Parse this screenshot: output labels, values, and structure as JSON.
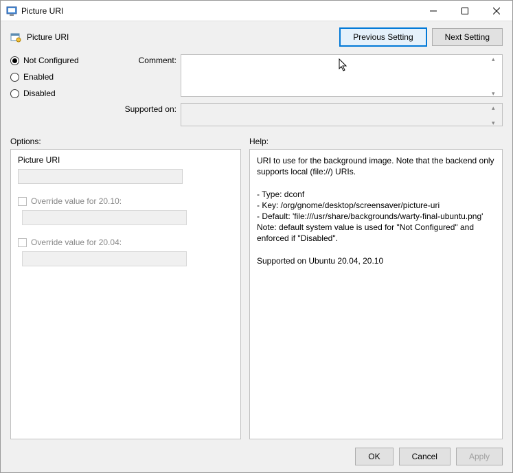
{
  "window": {
    "title": "Picture URI"
  },
  "header": {
    "policy_title": "Picture URI",
    "prev_btn": "Previous Setting",
    "next_btn": "Next Setting"
  },
  "state": {
    "radios": {
      "not_configured": "Not Configured",
      "enabled": "Enabled",
      "disabled": "Disabled",
      "selected": "not_configured"
    },
    "comment_label": "Comment:",
    "comment_value": "",
    "supported_label": "Supported on:",
    "supported_value": ""
  },
  "labels": {
    "options": "Options:",
    "help": "Help:"
  },
  "options": {
    "title": "Picture URI",
    "main_value": "",
    "override1_label": "Override value for 20.10:",
    "override1_value": "",
    "override2_label": "Override value for 20.04:",
    "override2_value": ""
  },
  "help_text": "URI to use for the background image. Note that the backend only supports local (file://) URIs.\n\n- Type: dconf\n- Key: /org/gnome/desktop/screensaver/picture-uri\n- Default: 'file:///usr/share/backgrounds/warty-final-ubuntu.png'\nNote: default system value is used for \"Not Configured\" and enforced if \"Disabled\".\n\nSupported on Ubuntu 20.04, 20.10",
  "footer": {
    "ok": "OK",
    "cancel": "Cancel",
    "apply": "Apply"
  }
}
